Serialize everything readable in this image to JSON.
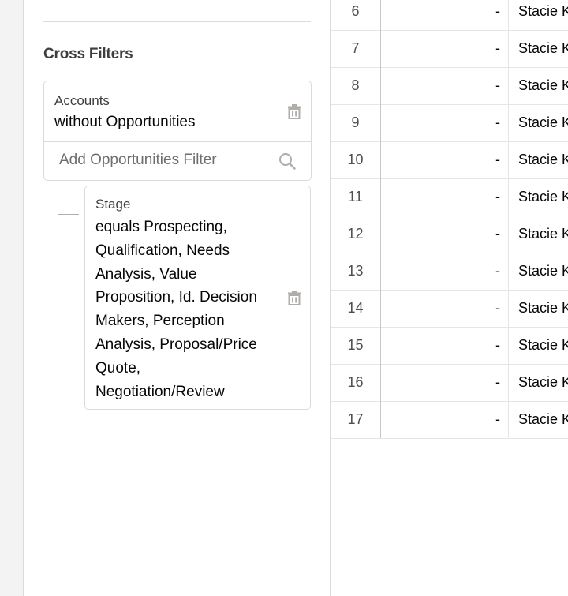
{
  "sidebar": {
    "section_title": "Cross Filters",
    "cross_filter": {
      "object_label": "Accounts",
      "condition": "without Opportunities",
      "add_filter_placeholder": "Add Opportunities Filter"
    },
    "sub_filter": {
      "field_label": "Stage",
      "condition": "equals Prospecting, Qualification, Needs Analysis, Value Proposition, Id. Decision Makers, Perception Analysis, Proposal/Price Quote, Negotiation/Review"
    }
  },
  "grid": {
    "rows": [
      {
        "num": "6",
        "value": "-",
        "owner": "Stacie K"
      },
      {
        "num": "7",
        "value": "-",
        "owner": "Stacie K"
      },
      {
        "num": "8",
        "value": "-",
        "owner": "Stacie K"
      },
      {
        "num": "9",
        "value": "-",
        "owner": "Stacie K"
      },
      {
        "num": "10",
        "value": "-",
        "owner": "Stacie K"
      },
      {
        "num": "11",
        "value": "-",
        "owner": "Stacie K"
      },
      {
        "num": "12",
        "value": "-",
        "owner": "Stacie K"
      },
      {
        "num": "13",
        "value": "-",
        "owner": "Stacie K"
      },
      {
        "num": "14",
        "value": "-",
        "owner": "Stacie K"
      },
      {
        "num": "15",
        "value": "-",
        "owner": "Stacie K"
      },
      {
        "num": "16",
        "value": "-",
        "owner": "Stacie K"
      },
      {
        "num": "17",
        "value": "-",
        "owner": "Stacie K"
      }
    ]
  },
  "icons": {
    "delete": "trash-icon",
    "search": "search-icon"
  },
  "colors": {
    "text_primary": "#080707",
    "text_label": "#3e3e3c",
    "border": "#dddbda",
    "icon": "#b0adab"
  }
}
